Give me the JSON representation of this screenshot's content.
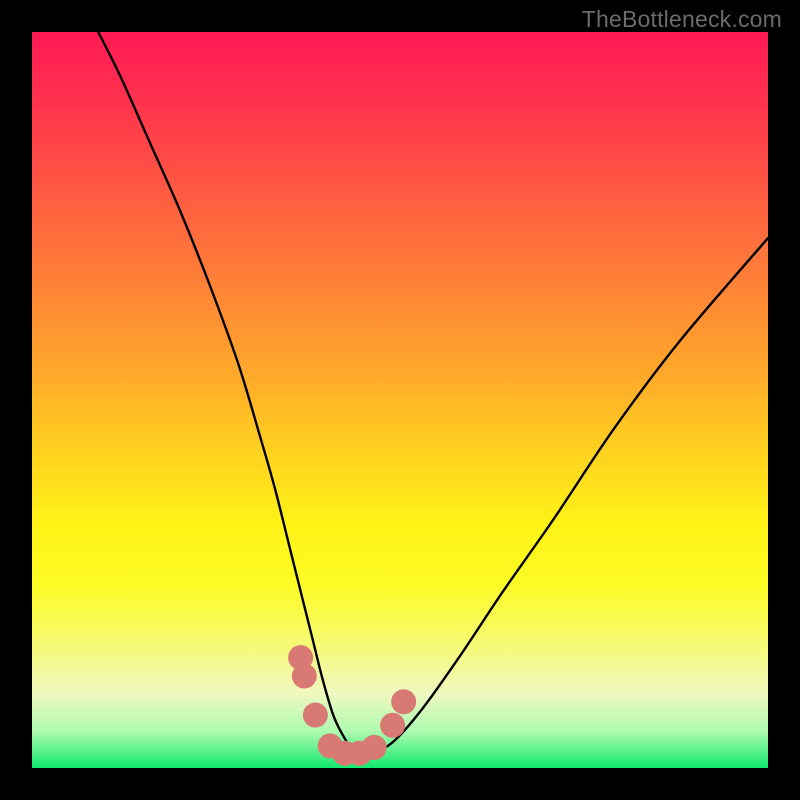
{
  "watermark": "TheBottleneck.com",
  "colors": {
    "background": "#000000",
    "curve_stroke": "#000000",
    "marker_fill": "#d87a73",
    "watermark_text": "#6b6b6b"
  },
  "chart_data": {
    "type": "line",
    "title": "",
    "xlabel": "",
    "ylabel": "",
    "xlim": [
      0,
      100
    ],
    "ylim": [
      0,
      100
    ],
    "grid": false,
    "series": [
      {
        "name": "bottleneck-curve",
        "x": [
          9,
          12,
          16,
          20,
          24,
          28,
          31,
          33,
          35,
          36.5,
          38,
          39.5,
          41,
          42.5,
          44,
          46,
          49,
          53,
          58,
          64,
          71,
          79,
          88,
          100
        ],
        "y": [
          100,
          94,
          85,
          76,
          66,
          55,
          45,
          38,
          30,
          24,
          18,
          12,
          7,
          4,
          2,
          2,
          3.5,
          8,
          15,
          24,
          34,
          46,
          58,
          72
        ]
      }
    ],
    "markers": [
      {
        "x": 36.5,
        "y": 15,
        "r": 1.7
      },
      {
        "x": 37.0,
        "y": 12.5,
        "r": 1.7
      },
      {
        "x": 38.5,
        "y": 7.2,
        "r": 1.7
      },
      {
        "x": 40.5,
        "y": 3.0,
        "r": 1.7
      },
      {
        "x": 42.5,
        "y": 2.0,
        "r": 1.7
      },
      {
        "x": 44.5,
        "y": 2.0,
        "r": 1.7
      },
      {
        "x": 46.5,
        "y": 2.8,
        "r": 1.7
      },
      {
        "x": 49.0,
        "y": 5.8,
        "r": 1.7
      },
      {
        "x": 50.5,
        "y": 9.0,
        "r": 1.7
      }
    ]
  }
}
